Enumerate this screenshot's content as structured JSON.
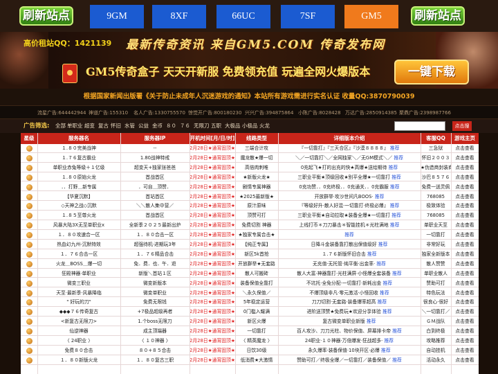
{
  "nav": {
    "refresh_left": "刷新站点",
    "refresh_right": "刷新站点",
    "tabs": [
      {
        "label": "9GM",
        "active": false
      },
      {
        "label": "8XF",
        "active": false
      },
      {
        "label": "66UC",
        "active": false
      },
      {
        "label": "7SF",
        "active": false
      },
      {
        "label": "GM5",
        "active": true
      }
    ]
  },
  "banner": {
    "qq": "高价租站QQ：1421139",
    "slogan": "最新传奇资讯 来自GM5.COM 传奇发布网",
    "promo": "GM5传奇盒子 天天开新服 免费领充值 玩遍全网火爆版本",
    "download": "一键下载"
  },
  "notice": "根据国家新闻出版署《关于防止未成年人沉迷游戏的通知》本站所有游戏需进行实名认证 收量QQ:3870790039",
  "adstrip": [
    "流星广告:644442944",
    "神道广告:155310",
    "名人广告:1330755570",
    "惊觉开广告:800180230",
    "兴兴广告:394875864",
    "小陈广告:8028428",
    "万达广告:2850914385",
    "聚鼎广告:2398987766"
  ],
  "filter": {
    "label": "广告筛选:",
    "items": [
      "全部",
      "单职业",
      "超变",
      "复古",
      "怀旧",
      "水管",
      "公益",
      "金币",
      "８０",
      "７６",
      "无限刀",
      "五职",
      "大极品",
      "小极品",
      "火龙"
    ],
    "search_placeholder": "",
    "search_button": "点击搜"
  },
  "table": {
    "headers": [
      "星级",
      "服务器名",
      "服务器IP",
      "开机时间[月/日/时]",
      "线路类型",
      "详细版本介绍",
      "客服QQ",
      "游戏主页"
    ],
    "rows": [
      {
        "name": "１.８０完美战神",
        "ip": "--",
        "time": "2月28日★通宵固顶★",
        "line": "三端合计攻",
        "desc": "『一切靠打』『三天合区』『沙漠８８８８』",
        "qq": "三急狱",
        "link": "点击查看"
      },
      {
        "name": "１.７６复古霸业",
        "ip": "1.80战神特戒",
        "time": "2月28日★通宵固顶★",
        "line": "魔龙散★爆一切",
        "desc": "＼／一切靠打＼／全网独家＼／无GM模式＼／",
        "qq": "怀旧２００３",
        "link": "点击查看"
      },
      {
        "name": "单职业赤兔等级＋１亿级",
        "ip": "超变天+独家张爸爸",
        "time": "2月28日★通宵固顶★",
        "line": "高倍肉刺唯",
        "desc": "0充起飞★打的出充的快★高爆★送给期待",
        "qq": "★伪造商封装商★",
        "link": "点击查看"
      },
      {
        "name": "１.８０原始火龙",
        "ip": "首战首区",
        "time": "2月28日★通宵固顶★",
        "line": "★新版火龙★",
        "desc": "三职业平衡★顶级回收★别平全爆★一切靠打",
        "qq": "沙巴８５７６",
        "link": "点击查看"
      },
      {
        "name": "．．打野＿新专属",
        "ip": "．可自＿顶赞．",
        "time": "2月28日★通宵固顶★",
        "line": "剧情专属神器",
        "desc": "0充功赞．．0充终极．．0充通关．．0充霸服",
        "qq": "免费一送灵佩",
        "link": "点击查看"
      },
      {
        "name": "【华夏沉默】",
        "ip": "首站首区",
        "time": "2月28日★通宵固顶★",
        "line": "★2025最新版★",
        "desc": "开放群举·攻沙世间凡BOOS·",
        "qq": "768085",
        "link": "点击查看"
      },
      {
        "name": "◇天神之战◇沉默",
        "ip": "＼＼散人集中营／",
        "time": "2月28日★通宵固顶★",
        "line": "原汁原味",
        "desc": "『等级好升·散人好混·一切靠打·终极必爆』",
        "qq": "极致体验",
        "link": "点击查看"
      },
      {
        "name": "１.８５至尊火龙",
        "ip": "首战首区",
        "time": "2月28日★通宵固顶★",
        "line": "顶赞可打",
        "desc": "三职业平衡★自动拉取★装备全爆★一切靠打",
        "qq": "768085",
        "link": "点击查看"
      },
      {
        "name": "风暴大陆3X无至单职业x",
        "ip": "全新季２０２５最新出炉",
        "time": "2月28日★通宵固顶★",
        "line": "免费切割 神器",
        "desc": "上线打币＊刀刀暴击＊智能挂机＊光柱满地",
        "qq": "单职业天至",
        "link": "点击查看"
      },
      {
        "name": "１．８０攻速合一区",
        "ip": "１．８０合击一区",
        "time": "2月28日★通宵固顶★",
        "line": "★独家专属合击★",
        "desc": "",
        "qq": "一切靠打",
        "link": "点击查看"
      },
      {
        "name": "热血幻九州-沉默特效",
        "ip": "超强待机·进期玩3年",
        "time": "2月28日★通宵固顶★",
        "line": "【纯正专属】",
        "desc": "日降斗金装备靠打散出保值级好",
        "qq": "非常好玩",
        "link": "点击查看"
      },
      {
        "name": "１．７６合击一区",
        "ip": "１．７６精品合击",
        "time": "2月28日★通宵固顶★",
        "line": "新区5k首抢",
        "desc": "１.７６新版怀旧合击",
        "qq": "独家全新版本",
        "link": "点击查看"
      },
      {
        "name": "火龙＿BOSS＿爆一切",
        "ip": "免．费．也．午．退",
        "time": "2月28日★通宵固顶★",
        "line": "开放群举★无套路",
        "desc": "无充值·无托管·纯平衡·出金率·",
        "qq": "散人赞赞",
        "link": "点击查看"
      },
      {
        "name": "狂殿神器·单职业",
        "ip": "新版＼首站１区",
        "time": "2月28日★通宵固顶★",
        "line": "散人可搬砖",
        "desc": "散人大富·神器靠打·光柱满屏·小怪爆全套装备",
        "qq": "单职业散人",
        "link": "点击查看"
      },
      {
        "name": "微变三职业",
        "ip": "微变新版本",
        "time": "2月28日★通宵固顶★",
        "line": "装备保值全靠打",
        "desc": "不坑托·全免分配·一切靠打·新耗出金",
        "qq": "赞助可打",
        "link": "点击查看"
      },
      {
        "name": "天至·最新季·风暴降临",
        "ip": "微变单职业",
        "time": "2月28日★通宵固顶★",
        "line": "＼永久保值／",
        "desc": "不爆顶级非凡·零元激活·小怪回收",
        "qq": "特色玩法",
        "link": "点击查看"
      },
      {
        "name": "\" 好玩的刀\"",
        "ip": "免费无限钱",
        "time": "2月28日★通宵固顶★",
        "line": "5年稳定运营",
        "desc": "刀刀切割·无套路·装备爆率超高",
        "qq": "很良心·很好",
        "link": "点击查看"
      },
      {
        "name": "◆◆◆７６传奇复古",
        "ip": "+7极品超级再者",
        "time": "2月28日★通宵固顶★",
        "line": "0门槛入耀满",
        "desc": "进阶送顶赞★免费玩★欢迎分享体验",
        "qq": "＼一切靠打／",
        "link": "点击查看"
      },
      {
        "name": "<新复古无限刀>",
        "ip": "1.个boss无限刀",
        "time": "2月28日★通宵固顶★",
        "line": "新区火爆",
        "desc": "复古微变单职业新版",
        "qq": "ＧＭ战队",
        "link": "点击查看"
      },
      {
        "name": "仙逆神器",
        "ip": "成主顶端器",
        "time": "2月28日★通宵固顶★",
        "line": "一切靠打",
        "desc": "百人攻沙、刀刀光柱、物价保值、屏幕排卡帝",
        "qq": "白到终极",
        "link": "点击查看"
      },
      {
        "name": "〈 24职业 〉",
        "ip": "〈 １０神器 〉",
        "time": "2月28日★通宵固顶★",
        "line": "〈 精英魔龙 〉",
        "desc": "24职业·１０神器·万倍爆发·狂战超多·",
        "qq": "攻略推荐",
        "link": "点击查看"
      },
      {
        "name": "免费８０合击",
        "ip": "８０+８５合击",
        "time": "2月28日★通宵固顶★",
        "line": "日饮30级",
        "desc": "永久爆率·装备保值·10块开区·必爆",
        "qq": "自动挂机",
        "link": "点击查看"
      },
      {
        "name": "１．８０新版火龙",
        "ip": "１．８０复古三职",
        "time": "2月28日★通宵固顶★",
        "line": "低消费★大激情",
        "desc": "赞助可打／终极全爆／一切靠打／装备保值／",
        "qq": "活动永久",
        "link": "点击查看"
      }
    ],
    "recommend": "推荐"
  }
}
